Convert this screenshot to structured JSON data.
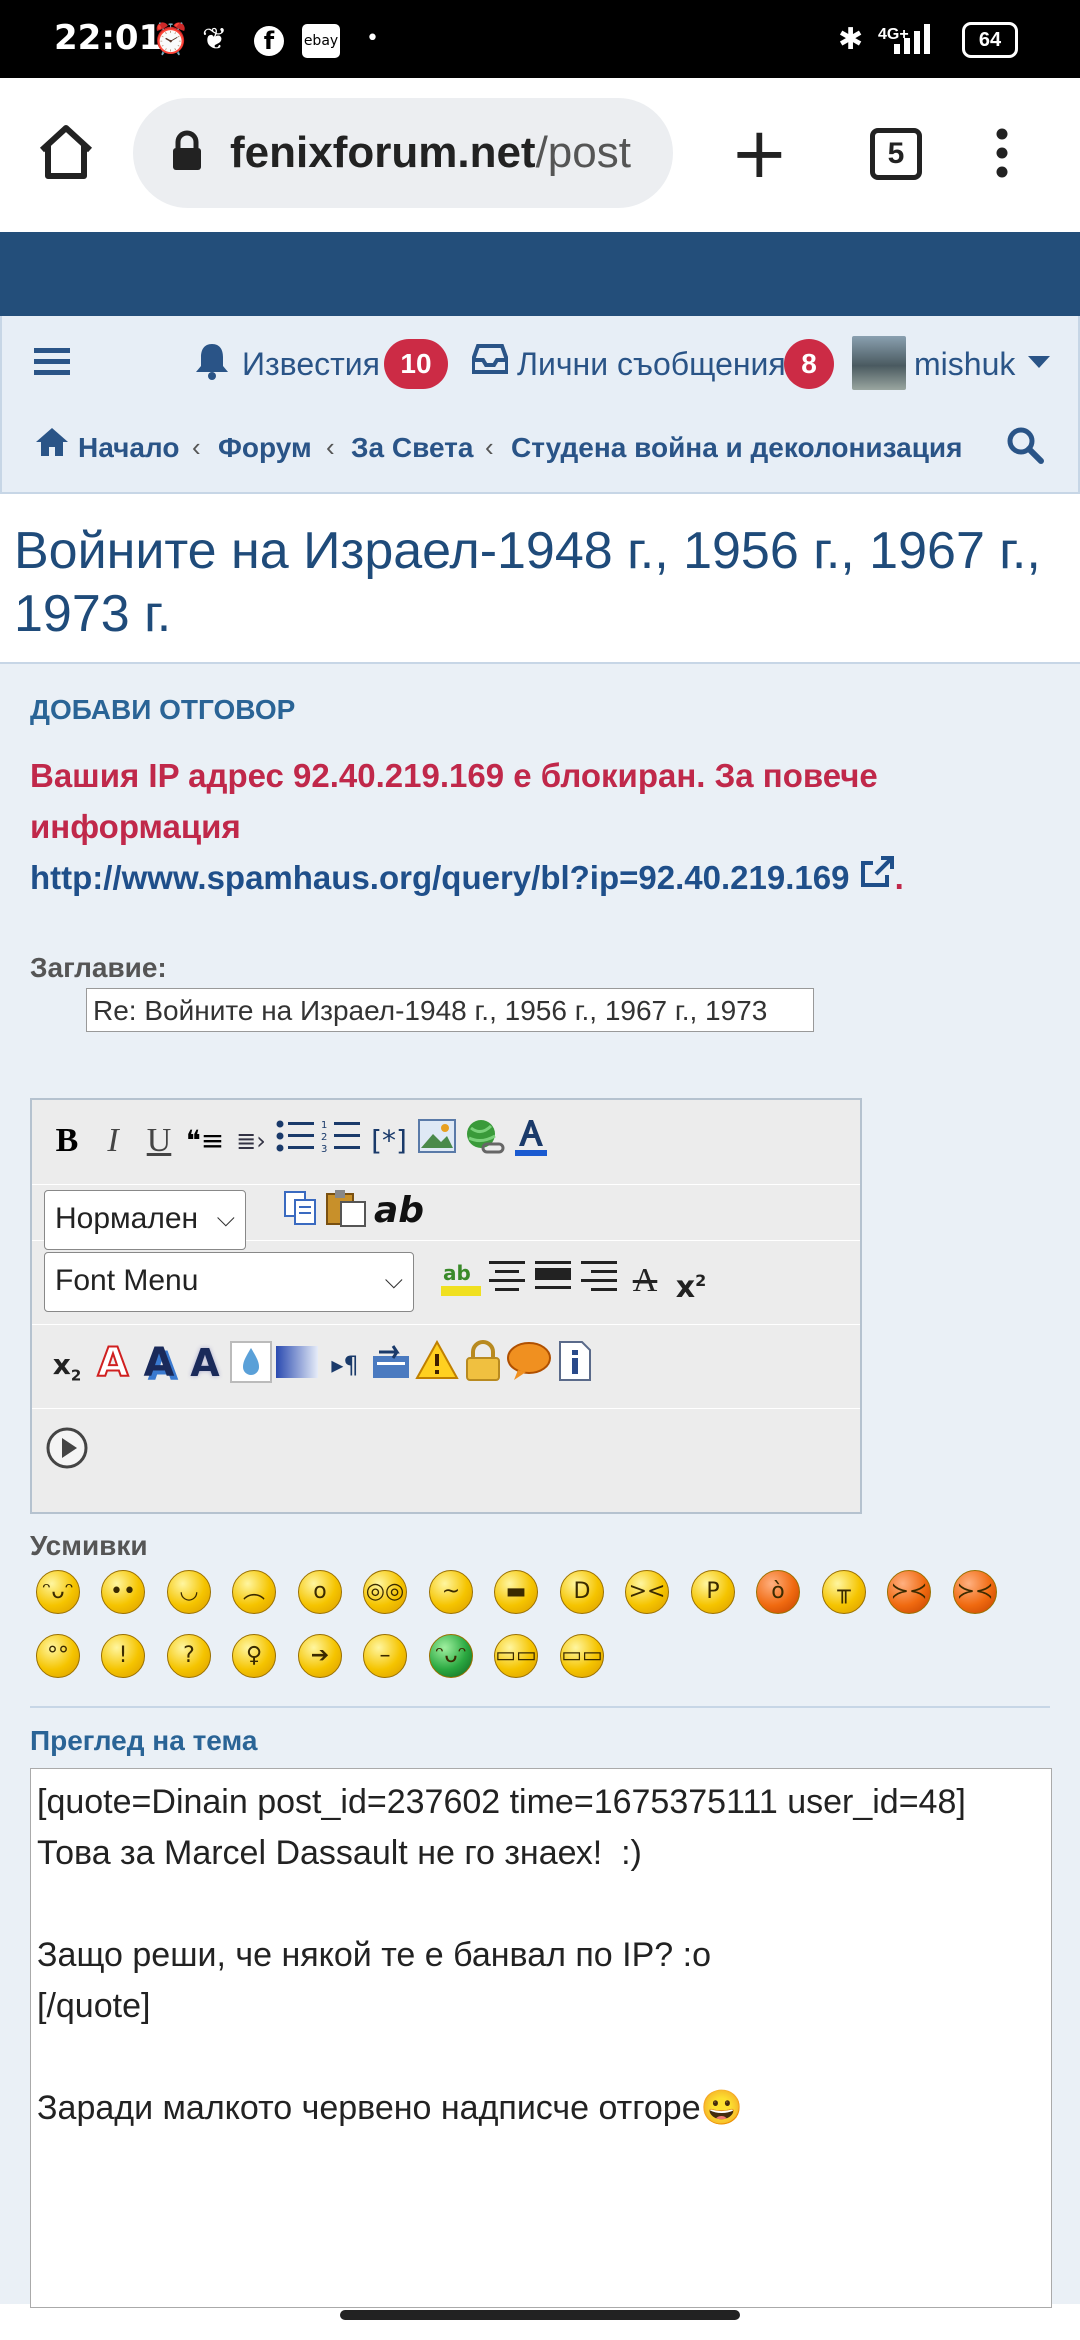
{
  "status_bar": {
    "time": "22:01",
    "battery": "64",
    "network": "4G+"
  },
  "browser": {
    "url_domain": "fenixforum.net",
    "url_path": "/post",
    "tab_count": "5"
  },
  "nav": {
    "notifications_label": "Известия",
    "notifications_count": "10",
    "messages_label": "Лични съобщения",
    "messages_count": "8",
    "username": "mishuk"
  },
  "breadcrumb": [
    "Начало",
    "Форум",
    "За Света",
    "Студена война и деколонизация"
  ],
  "page_title": "Войните на Израел-1948 г., 1956 г., 1967 г., 1973 г.",
  "reply": {
    "heading": "ДОБАВИ ОТГОВОР",
    "error_text": "Вашия IP адрес 92.40.219.169 е блокиран. За повече информация",
    "error_link": "http://www.spamhaus.org/query/bl?ip=92.40.219.169",
    "subject_label": "Заглавие:",
    "subject_value": "Re: Войните на Израел-1948 г., 1956 г., 1967 г., 1973",
    "format_select": "Нормален",
    "font_select": "Font Menu",
    "smilies_label": "Усмивки",
    "preview_label": "Преглед на тема",
    "message": "[quote=Dinain post_id=237602 time=1675375111 user_id=48]\nТова за Marcel Dassault не го знаех!  :)\n\nЗащо реши, че някой те е банвал по IP? :o\n[/quote]\n\nЗаради малкото червено надписче отгоре😀"
  },
  "colors": {
    "banner": "#234e7a",
    "nav_bg": "#e7eef6",
    "link": "#2a5487",
    "badge": "#cc2b45",
    "error": "#c0284a"
  }
}
